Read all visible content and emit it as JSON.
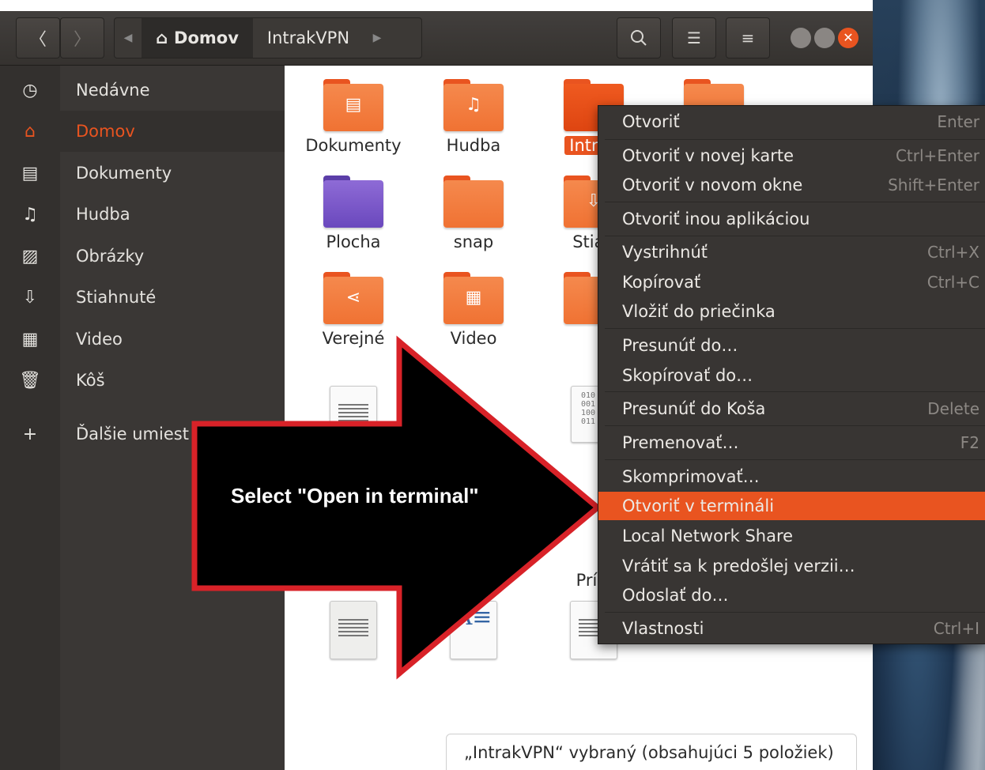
{
  "header": {
    "back_icon": "chevron-left-icon",
    "forward_icon": "chevron-right-icon",
    "breadcrumbs": [
      "Domov",
      "IntrakVPN"
    ],
    "search_icon": "search-icon",
    "view_icon": "list-view-icon",
    "menu_icon": "hamburger-icon"
  },
  "sidebar": {
    "items": [
      {
        "label": "Nedávne",
        "icon": "clock-icon"
      },
      {
        "label": "Domov",
        "icon": "home-icon"
      },
      {
        "label": "Dokumenty",
        "icon": "document-icon"
      },
      {
        "label": "Hudba",
        "icon": "music-icon"
      },
      {
        "label": "Obrázky",
        "icon": "picture-icon"
      },
      {
        "label": "Stiahnuté",
        "icon": "download-icon"
      },
      {
        "label": "Video",
        "icon": "film-icon"
      },
      {
        "label": "Kôš",
        "icon": "trash-icon"
      },
      {
        "label": "Ďalšie umiest",
        "icon": "plus-icon"
      }
    ]
  },
  "files": [
    {
      "name": "Dokumenty"
    },
    {
      "name": "Hudba"
    },
    {
      "name": "Intrak"
    },
    {
      "name": "Plocha"
    },
    {
      "name": "snap"
    },
    {
      "name": "Stiah"
    },
    {
      "name": "Verejné"
    },
    {
      "name": "Video"
    },
    {
      "name": "Príkl"
    }
  ],
  "context_menu": {
    "items": [
      {
        "label": "Otvoriť",
        "shortcut": "Enter"
      },
      {
        "label": "Otvoriť v novej karte",
        "shortcut": "Ctrl+Enter"
      },
      {
        "label": "Otvoriť v novom okne",
        "shortcut": "Shift+Enter"
      },
      {
        "label": "Otvoriť inou aplikáciou",
        "shortcut": ""
      },
      {
        "label": "Vystrihnúť",
        "shortcut": "Ctrl+X"
      },
      {
        "label": "Kopírovať",
        "shortcut": "Ctrl+C"
      },
      {
        "label": "Vložiť do priečinka",
        "shortcut": ""
      },
      {
        "label": "Presunúť do…",
        "shortcut": ""
      },
      {
        "label": "Skopírovať do…",
        "shortcut": ""
      },
      {
        "label": "Presunúť do Koša",
        "shortcut": "Delete"
      },
      {
        "label": "Premenovať…",
        "shortcut": "F2"
      },
      {
        "label": "Skomprimovať…",
        "shortcut": ""
      },
      {
        "label": "Otvoriť v termináli",
        "shortcut": ""
      },
      {
        "label": "Local Network Share",
        "shortcut": ""
      },
      {
        "label": "Vrátiť sa k predošlej verzii…",
        "shortcut": ""
      },
      {
        "label": "Odoslať do…",
        "shortcut": ""
      },
      {
        "label": "Vlastnosti",
        "shortcut": "Ctrl+I"
      }
    ]
  },
  "status": "„IntrakVPN“ vybraný (obsahujúci 5 položiek)",
  "annotation": "Select \"Open in terminal\"",
  "colors": {
    "accent": "#e95420",
    "folder": "#f07233",
    "menu_bg": "#383533"
  }
}
